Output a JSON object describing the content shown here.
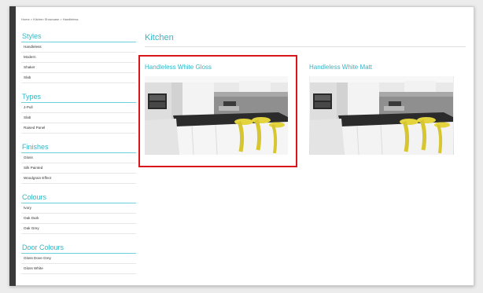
{
  "breadcrumb": "Home > Kitchen Showcase > Handleless",
  "sidebar": {
    "groups": [
      {
        "title": "Styles",
        "items": [
          "Handleless",
          "Modern",
          "Shaker",
          "Slab"
        ]
      },
      {
        "title": "Types",
        "items": [
          "J-Pull",
          "Slab",
          "Raised Panel"
        ]
      },
      {
        "title": "Finishes",
        "items": [
          "Gloss",
          "Silk Painted",
          "Woodgrain Effect"
        ]
      },
      {
        "title": "Colours",
        "items": [
          "Ivory",
          "Oak Dark",
          "Oak Grey"
        ]
      },
      {
        "title": "Door Colours",
        "items": [
          "Gloss Dove Grey",
          "Gloss White"
        ]
      }
    ]
  },
  "main": {
    "title": "Kitchen",
    "products": [
      {
        "name": "Handleless White Gloss",
        "highlighted": true
      },
      {
        "name": "Handleless White Matt",
        "highlighted": false
      }
    ]
  },
  "colors": {
    "accent": "#2bb8c8",
    "highlight": "#d9151c",
    "stool": "#d9c93a"
  }
}
